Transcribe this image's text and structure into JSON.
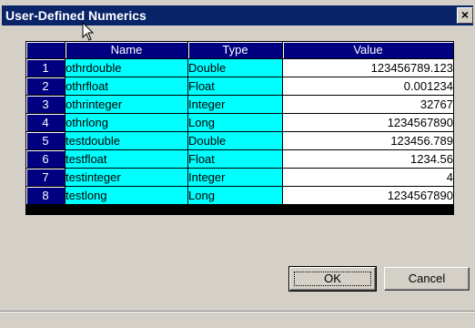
{
  "window": {
    "title": "User-Defined Numerics",
    "close_glyph": "×"
  },
  "grid": {
    "columns": [
      "",
      "Name",
      "Type",
      "Value"
    ],
    "rows": [
      {
        "num": "1",
        "name": "othrdouble",
        "type": "Double",
        "value": "123456789.123"
      },
      {
        "num": "2",
        "name": "othrfloat",
        "type": "Float",
        "value": "0.001234"
      },
      {
        "num": "3",
        "name": "othrinteger",
        "type": "Integer",
        "value": "32767"
      },
      {
        "num": "4",
        "name": "othrlong",
        "type": "Long",
        "value": "1234567890"
      },
      {
        "num": "5",
        "name": "testdouble",
        "type": "Double",
        "value": "123456.789"
      },
      {
        "num": "6",
        "name": "testfloat",
        "type": "Float",
        "value": "1234.56"
      },
      {
        "num": "7",
        "name": "testinteger",
        "type": "Integer",
        "value": "4"
      },
      {
        "num": "8",
        "name": "testlong",
        "type": "Long",
        "value": "1234567890"
      }
    ]
  },
  "buttons": {
    "ok_label": "OK",
    "cancel_label": "Cancel"
  },
  "status": {
    "text": ""
  },
  "icons": {
    "close": "close-icon",
    "cursor": "mouse-pointer-icon"
  },
  "colors": {
    "title_bar": "#0a246a",
    "header": "#000080",
    "name_cell": "#00ffff",
    "window_face": "#d4d0c8"
  }
}
